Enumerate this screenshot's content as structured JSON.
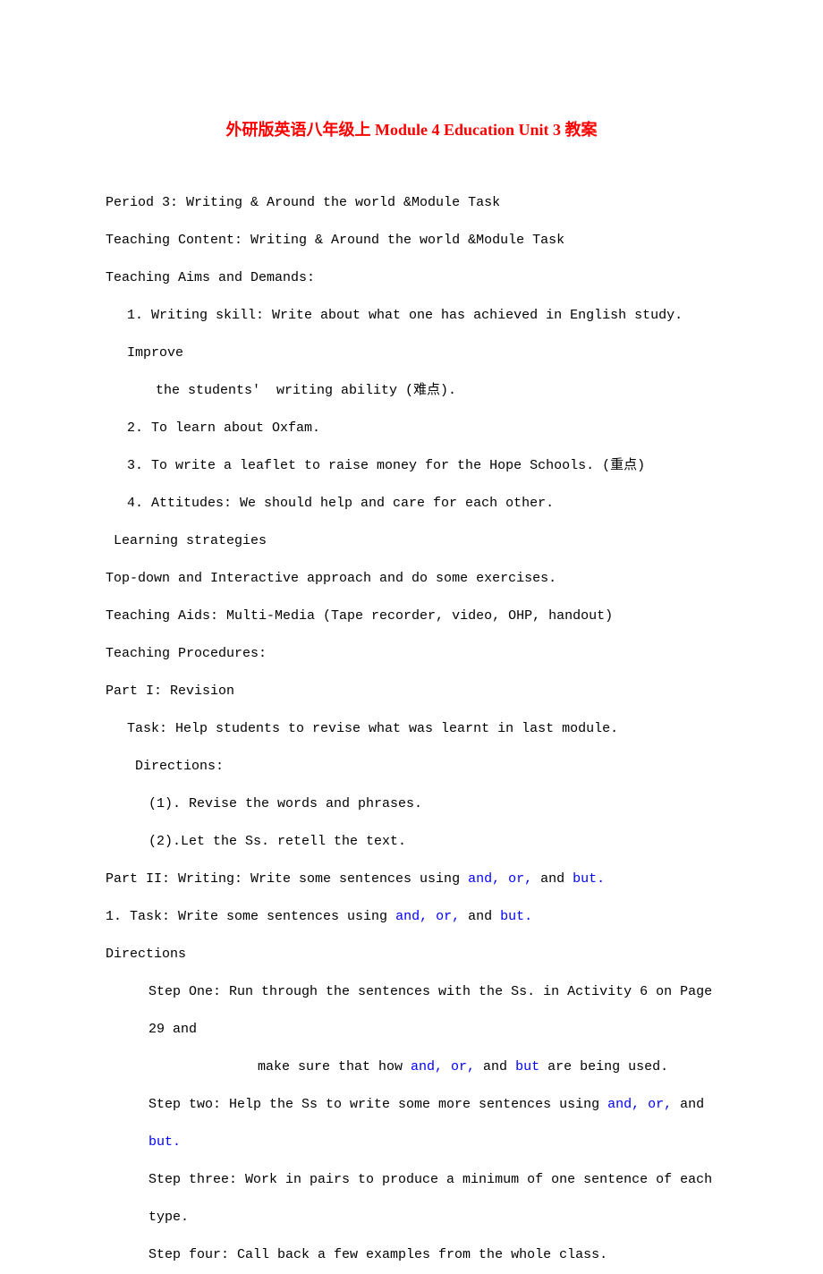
{
  "title": "外研版英语八年级上 Module 4 Education Unit 3 教案",
  "l1": "Period 3: Writing & Around the world &Module Task",
  "l2": "Teaching Content: Writing & Around the world &Module Task",
  "l3": "Teaching Aims and Demands:",
  "l4": "1. Writing skill: Write about what one has achieved in English study. Improve",
  "l5": "the students'  writing ability (难点).",
  "l6": "2. To learn about Oxfam.",
  "l7": "3. To write a leaflet to raise money for the Hope Schools. (重点)",
  "l8": "4. Attitudes: We should help and care for each other.",
  "l9": " Learning strategies",
  "l10": "Top-down and Interactive approach and do some exercises.",
  "l11": "Teaching Aids: Multi-Media (Tape recorder, video, OHP, handout)",
  "l12": "Teaching Procedures:",
  "l13": "Part I: Revision",
  "l14": "Task: Help students to revise what was learnt in last module.",
  "l15": " Directions:",
  "l16": "(1). Revise the words and phrases.",
  "l17": "(2).Let the Ss. retell the text.",
  "l18a": "Part II: Writing: Write some sentences using ",
  "l18b": "and, or,",
  "l18c": " and ",
  "l18d": "but.",
  "l19a": "1. Task: Write some sentences using ",
  "l19b": "and, or,",
  "l19c": " and ",
  "l19d": "but.",
  "l20": "Directions",
  "l21a": "Step One: Run through the sentences with the Ss. in Activity 6 on Page 29 and",
  "l22a": "make sure that how ",
  "l22b": "and, or,",
  "l22c": " and ",
  "l22d": "but",
  "l22e": " are being used.",
  "l23a": "Step two: Help the Ss to write some more sentences using ",
  "l23b": "and, or,",
  "l23c": " and ",
  "l23d": "but.",
  "l24": "Step three: Work in pairs to produce a minimum of one sentence of each type.",
  "l25": "Step four: Call back a few examples from the whole class."
}
